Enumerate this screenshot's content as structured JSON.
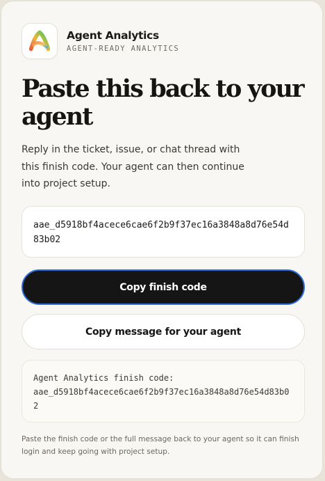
{
  "brand": {
    "name": "Agent Analytics",
    "tagline": "AGENT-READY ANALYTICS",
    "logo_icon": "agent-analytics-logo-icon"
  },
  "main": {
    "title": "Paste this back to your agent",
    "description": "Reply in the ticket, issue, or chat thread with this finish code. Your agent can then continue into project setup.",
    "finish_code": "aae_d5918bf4acece6cae6f2b9f37ec16a3848a8d76e54d83b02",
    "copy_code_label": "Copy finish code",
    "copy_message_label": "Copy message for your agent",
    "message_line1": "Agent Analytics finish code:",
    "message_line2": "aae_d5918bf4acece6cae6f2b9f37ec16a3848a8d76e54d83b02",
    "footnote": "Paste the finish code or the full message back to your agent so it can finish login and keep going with project setup."
  },
  "colors": {
    "page_background": "#f8f7f3",
    "primary_button": "#151515",
    "focus_ring": "#2f6fd6",
    "logo_gradient": [
      "#e8613c",
      "#f3b33d",
      "#8bc34a",
      "#3ba8c4"
    ]
  }
}
